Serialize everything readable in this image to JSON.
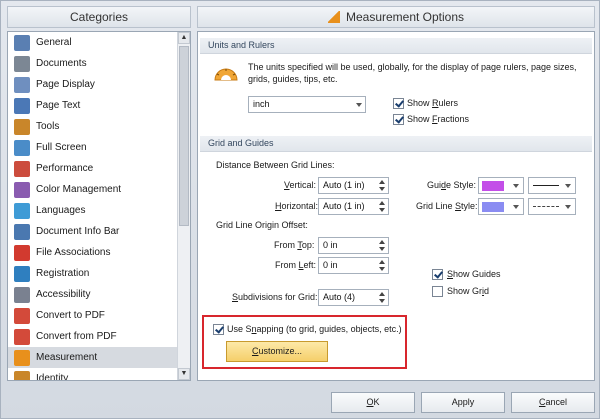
{
  "categories": {
    "header": "Categories",
    "items": [
      {
        "label": "General",
        "icon": "general-icon",
        "color": "#5a7fb2"
      },
      {
        "label": "Documents",
        "icon": "documents-icon",
        "color": "#7c8794"
      },
      {
        "label": "Page Display",
        "icon": "page-display-icon",
        "color": "#6f8fbf"
      },
      {
        "label": "Page Text",
        "icon": "page-text-icon",
        "color": "#4b78b6"
      },
      {
        "label": "Tools",
        "icon": "tools-icon",
        "color": "#c9862a"
      },
      {
        "label": "Full Screen",
        "icon": "full-screen-icon",
        "color": "#4a8cc8"
      },
      {
        "label": "Performance",
        "icon": "performance-icon",
        "color": "#cc4c3d"
      },
      {
        "label": "Color Management",
        "icon": "color-management-icon",
        "color": "#8a5bb0"
      },
      {
        "label": "Languages",
        "icon": "languages-icon",
        "color": "#3f9bd6"
      },
      {
        "label": "Document Info Bar",
        "icon": "document-info-bar-icon",
        "color": "#4a78b0"
      },
      {
        "label": "File Associations",
        "icon": "file-associations-icon",
        "color": "#d23a2f"
      },
      {
        "label": "Registration",
        "icon": "registration-icon",
        "color": "#2f7fbf"
      },
      {
        "label": "Accessibility",
        "icon": "accessibility-icon",
        "color": "#7a8190"
      },
      {
        "label": "Convert to PDF",
        "icon": "convert-to-pdf-icon",
        "color": "#d34a3a"
      },
      {
        "label": "Convert from PDF",
        "icon": "convert-from-pdf-icon",
        "color": "#d34a3a"
      },
      {
        "label": "Measurement",
        "icon": "measurement-icon",
        "color": "#e8901c",
        "selected": true
      },
      {
        "label": "Identity",
        "icon": "identity-icon",
        "color": "#c9862a"
      }
    ]
  },
  "options": {
    "header": "Measurement Options",
    "units_group": {
      "title": "Units and Rulers",
      "description_line1": "The units specified will be used, globally, for the display of page rulers, page sizes,",
      "description_line2": "grids, guides, tips, etc.",
      "unit_value": "inch",
      "show_rulers": {
        "label_pre": "Show ",
        "label_u": "R",
        "label_post": "ulers",
        "checked": true
      },
      "show_fractions": {
        "label_pre": "Show ",
        "label_u": "F",
        "label_post": "ractions",
        "checked": true
      }
    },
    "grid_group": {
      "title": "Grid and Guides",
      "distance_label": "Distance Between Grid Lines:",
      "vertical": {
        "label_u": "V",
        "label_post": "ertical:",
        "value": "Auto (1 in)"
      },
      "horizontal": {
        "label_u": "H",
        "label_post": "orizontal:",
        "value": "Auto (1 in)"
      },
      "origin_label": "Grid Line Origin Offset:",
      "from_top": {
        "label_pre": "From ",
        "label_u": "T",
        "label_post": "op:",
        "value": "0 in"
      },
      "from_left": {
        "label_pre": "From ",
        "label_u": "L",
        "label_post": "eft:",
        "value": "0 in"
      },
      "subdivisions": {
        "label_u": "S",
        "label_post": "ubdivisions for Grid:",
        "value": "Auto (4)"
      },
      "guide_style": {
        "label_pre": "Gui",
        "label_u": "d",
        "label_post": "e Style:",
        "color": "#c34ee8"
      },
      "grid_line_style": {
        "label_pre": "Grid Line ",
        "label_u": "S",
        "label_post": "tyle:",
        "color": "#8a8cf2"
      },
      "show_guides": {
        "label_u": "S",
        "label_post": "how Guides",
        "checked": true
      },
      "show_grid": {
        "label_pre": "Show Gr",
        "label_u": "i",
        "label_post": "d",
        "checked": false
      },
      "use_snapping": {
        "label_pre": "Use S",
        "label_u": "n",
        "label_post": "apping (to grid, guides, objects, etc.)",
        "checked": true
      },
      "customize_button": {
        "label_u": "C",
        "label_post": "ustomize..."
      }
    }
  },
  "buttons": {
    "ok": {
      "label_u": "O",
      "label_post": "K"
    },
    "apply": "Apply",
    "cancel": {
      "label_u": "C",
      "label_post": "ancel"
    }
  }
}
